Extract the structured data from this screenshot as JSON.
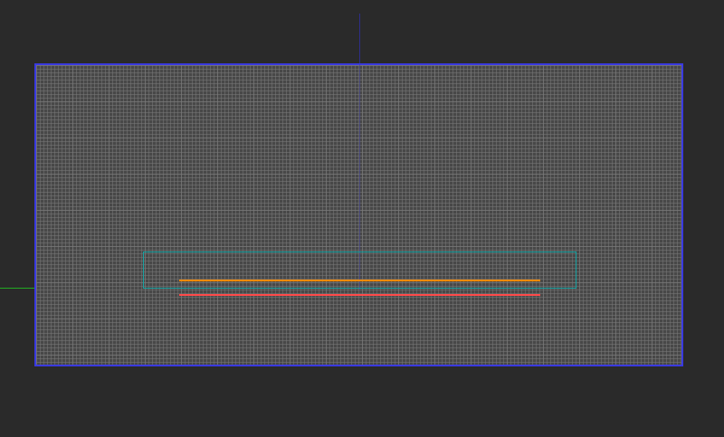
{
  "viewport": {
    "colors": {
      "background": "#2a2a2a",
      "canvas_border": "#3a3ae0",
      "selection_bounds": "#19a3a3",
      "line_orange": "#ff8a00",
      "line_red": "#ff4a4a",
      "x_axis": "#22aa22",
      "y_axis": "#2e2e8a"
    }
  }
}
